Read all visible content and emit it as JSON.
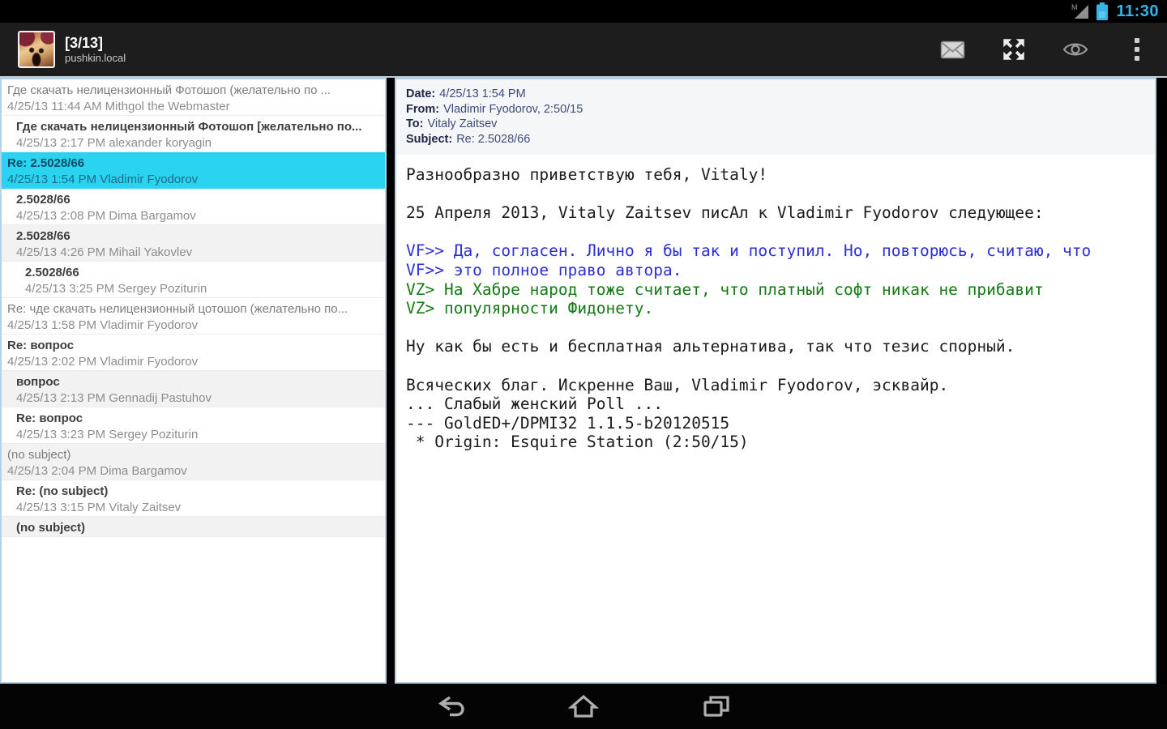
{
  "status_bar": {
    "time": "11:30",
    "accent_color": "#33b5e5",
    "signal_badge": "M"
  },
  "action_bar": {
    "title": "[3/13]",
    "subtitle": "pushkin.local",
    "background": "#1d1d1d",
    "actions": [
      "mail",
      "fullscreen",
      "toggle-view",
      "overflow-menu"
    ]
  },
  "message_list": {
    "selected_background": "#2ad4f0",
    "items": [
      {
        "subject": "Где скачать нелицензионный Фотошоп (желательно по ...",
        "meta": "4/25/13 11:44 AM Mithgol the Webmaster",
        "depth": 0,
        "unread": false,
        "shaded": false,
        "selected": false
      },
      {
        "subject": "Где скачать нелицензионный Фотошоп [желательно по...",
        "meta": "4/25/13 2:17 PM alexander koryagin",
        "depth": 1,
        "unread": true,
        "shaded": false,
        "selected": false
      },
      {
        "subject": "Re: 2.5028/66",
        "meta": "4/25/13 1:54 PM Vladimir Fyodorov",
        "depth": 0,
        "unread": true,
        "shaded": false,
        "selected": true
      },
      {
        "subject": "2.5028/66",
        "meta": "4/25/13 2:08 PM Dima Bargamov",
        "depth": 1,
        "unread": true,
        "shaded": false,
        "selected": false
      },
      {
        "subject": "2.5028/66",
        "meta": "4/25/13 4:26 PM Mihail Yakovlev",
        "depth": 1,
        "unread": true,
        "shaded": true,
        "selected": false
      },
      {
        "subject": "2.5028/66",
        "meta": "4/25/13 3:25 PM Sergey Poziturin",
        "depth": 2,
        "unread": true,
        "shaded": false,
        "selected": false
      },
      {
        "subject": "Re: чде скачать нелицензионный цотошоп (желательно по...",
        "meta": "4/25/13 1:58 PM Vladimir Fyodorov",
        "depth": 0,
        "unread": false,
        "shaded": false,
        "selected": false
      },
      {
        "subject": "Re: вопрос",
        "meta": "4/25/13 2:02 PM Vladimir Fyodorov",
        "depth": 0,
        "unread": true,
        "shaded": false,
        "selected": false
      },
      {
        "subject": "вопрос",
        "meta": "4/25/13 2:13 PM Gennadij Pastuhov",
        "depth": 1,
        "unread": true,
        "shaded": true,
        "selected": false
      },
      {
        "subject": "Re: вопрос",
        "meta": "4/25/13 3:23 PM Sergey Poziturin",
        "depth": 1,
        "unread": true,
        "shaded": false,
        "selected": false
      },
      {
        "subject": "(no subject)",
        "meta": "4/25/13 2:04 PM Dima Bargamov",
        "depth": 0,
        "unread": false,
        "shaded": true,
        "selected": false
      },
      {
        "subject": "Re: (no subject)",
        "meta": "4/25/13 3:15 PM Vitaly Zaitsev",
        "depth": 1,
        "unread": true,
        "shaded": false,
        "selected": false
      },
      {
        "subject": "(no subject)",
        "meta": "",
        "depth": 1,
        "unread": true,
        "shaded": true,
        "selected": false
      }
    ]
  },
  "message_view": {
    "headers": [
      {
        "label": "Date:",
        "value": "4/25/13 1:54 PM"
      },
      {
        "label": "From:",
        "value": "Vladimir Fyodorov, 2:50/15"
      },
      {
        "label": "To:",
        "value": "Vitaly Zaitsev"
      },
      {
        "label": "Subject:",
        "value": "Re: 2.5028/66"
      }
    ],
    "quote_colors": {
      "VF": "#2b2fd4",
      "VZ": "#157a15"
    },
    "body_lines": [
      {
        "text": "Разнообразно приветствую тебя, Vitaly!",
        "color": "normal"
      },
      {
        "text": "",
        "color": "normal"
      },
      {
        "text": "25 Апреля 2013, Vitaly Zaitsev писАл к Vladimir Fyodorov следующее:",
        "color": "normal"
      },
      {
        "text": "",
        "color": "normal"
      },
      {
        "text": "VF>> Да, согласен. Лично я бы так и поступил. Но, повторюсь, считаю, что",
        "color": "blue"
      },
      {
        "text": "VF>> это полное право автора.",
        "color": "blue"
      },
      {
        "text": "VZ> На Хабре народ тоже считает, что платный софт никак не прибавит",
        "color": "green"
      },
      {
        "text": "VZ> популярности Фидонету.",
        "color": "green"
      },
      {
        "text": "",
        "color": "normal"
      },
      {
        "text": "Ну как бы есть и бесплатная альтернатива, так что тезис спорный.",
        "color": "normal"
      },
      {
        "text": "",
        "color": "normal"
      },
      {
        "text": "Всяческих благ. Искренне Ваш, Vladimir Fyodorov, эсквайр.",
        "color": "normal"
      },
      {
        "text": "... Слабый женский Poll ...",
        "color": "normal"
      },
      {
        "text": "--- GoldED+/DPMI32 1.1.5-b20120515",
        "color": "normal"
      },
      {
        "text": " * Origin: Esquire Station (2:50/15)",
        "color": "normal"
      }
    ]
  },
  "nav_bar": {
    "buttons": [
      "back",
      "home",
      "recent-apps"
    ]
  }
}
